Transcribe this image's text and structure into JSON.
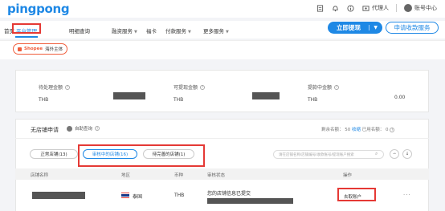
{
  "header": {
    "logo": "pingpong",
    "agent_label": "代理人",
    "account_label": "账号中心"
  },
  "nav": {
    "items": [
      {
        "label": "首页",
        "caret": false
      },
      {
        "label": "平台管理",
        "caret": false,
        "active": true
      },
      {
        "label": "明细查询",
        "caret": false
      },
      {
        "label": "融资服务",
        "caret": true
      },
      {
        "label": "福卡",
        "caret": false
      },
      {
        "label": "付款服务",
        "caret": true
      },
      {
        "label": "更多服务",
        "caret": true
      }
    ],
    "withdraw_label": "立即提现",
    "apply_label": "申请收款服务"
  },
  "platform": {
    "shop_name": "Shopee",
    "shop_region": "海外主体"
  },
  "balances": [
    {
      "label": "待处理金额",
      "currency": "THB"
    },
    {
      "label": "可提现金额",
      "currency": "THB"
    },
    {
      "label": "提款中金额",
      "currency": "THB",
      "value": "0.00"
    }
  ],
  "shops_section": {
    "title": "无店铺申请",
    "badge": "自助查询",
    "remaining_label": "剩余名额：",
    "remaining_value": "50",
    "remaining_link": "收缩",
    "used_label": "已用名额：",
    "used_value": "0"
  },
  "tabs": [
    {
      "label": "正常店铺(13)"
    },
    {
      "label": "审核中的店铺(16)",
      "active": true
    },
    {
      "label": "待完善的店铺(1)"
    }
  ],
  "search": {
    "placeholder": "请在店铺名称/店铺编号/收款账号/提现账户搜索"
  },
  "table": {
    "headers": [
      "店铺名称",
      "地区",
      "币种",
      "审核状态",
      "操作"
    ],
    "rows": [
      {
        "region": "泰国",
        "currency": "THB",
        "status": "您的店铺信息已提交",
        "action": "去取账户"
      }
    ]
  },
  "colors": {
    "accent": "#1e88e5",
    "highlight_border": "#e53935",
    "shopee": "#f05d3b"
  }
}
